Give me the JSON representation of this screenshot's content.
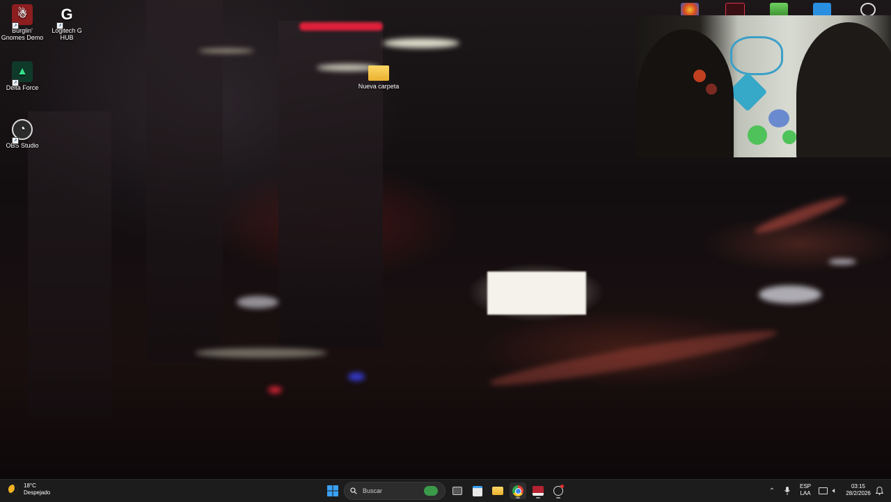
{
  "desktop": {
    "icons": [
      {
        "label": "Burglin' Gnomes Demo",
        "icon": "gnome-app-icon"
      },
      {
        "label": "Logitech G HUB",
        "icon": "logitech-g-icon"
      },
      {
        "label": "Delta Force",
        "icon": "delta-force-icon"
      },
      {
        "label": "OBS Studio",
        "icon": "obs-icon"
      },
      {
        "label": "Nueva carpeta",
        "icon": "folder-icon"
      }
    ]
  },
  "taskbar": {
    "weather": {
      "temp": "18°C",
      "condition": "Despejado"
    },
    "search_placeholder": "Buscar",
    "tray": {
      "lang_top": "ESP",
      "lang_bottom": "LAA",
      "time": "03:15",
      "date": "28/2/2026"
    }
  },
  "colors": {
    "taskbar_bg": "#1c1c1c",
    "windows_blue": "#3aa0f3",
    "folder_yellow": "#f5c242"
  }
}
